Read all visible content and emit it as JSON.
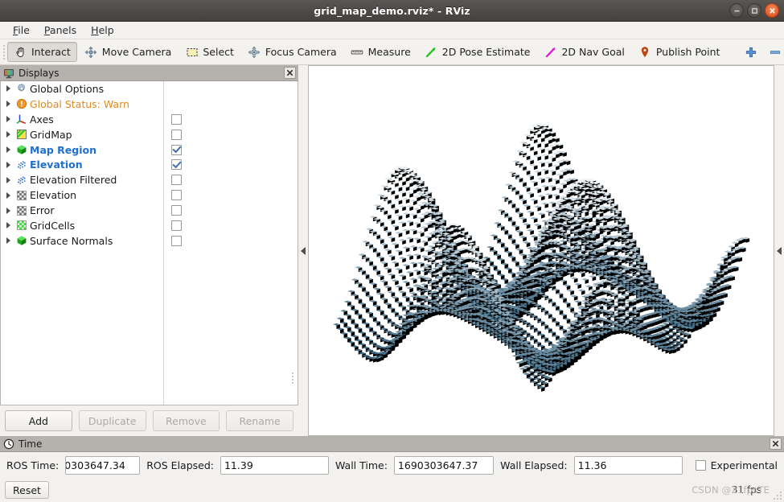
{
  "window": {
    "title": "grid_map_demo.rviz* - RViz",
    "buttons": {
      "minimize": "minimize",
      "maximize": "maximize",
      "close": "close"
    }
  },
  "menubar": {
    "items": [
      {
        "label": "File",
        "mnemonic": "F"
      },
      {
        "label": "Panels",
        "mnemonic": "P"
      },
      {
        "label": "Help",
        "mnemonic": "H"
      }
    ]
  },
  "toolbar": {
    "tools": [
      {
        "label": "Interact",
        "icon": "hand-cursor-icon",
        "active": true
      },
      {
        "label": "Move Camera",
        "icon": "move-camera-icon",
        "active": false
      },
      {
        "label": "Select",
        "icon": "select-rect-icon",
        "active": false
      },
      {
        "label": "Focus Camera",
        "icon": "focus-camera-icon",
        "active": false
      },
      {
        "label": "Measure",
        "icon": "ruler-icon",
        "active": false
      },
      {
        "label": "2D Pose Estimate",
        "icon": "green-arrow-icon",
        "active": false
      },
      {
        "label": "2D Nav Goal",
        "icon": "magenta-arrow-icon",
        "active": false
      },
      {
        "label": "Publish Point",
        "icon": "map-pin-icon",
        "active": false
      }
    ],
    "extras": [
      {
        "icon": "plus-icon",
        "label": "",
        "has_caret": false
      },
      {
        "icon": "minus-icon",
        "label": "",
        "has_caret": true
      },
      {
        "icon": "eye-icon",
        "label": "",
        "has_caret": true
      }
    ]
  },
  "displays": {
    "panel_title": "Displays",
    "panel_icon": "monitor-icon",
    "close_icon": "close-icon",
    "tree": [
      {
        "label": "Global Options",
        "icon": "gear-icon",
        "style": "normal",
        "has_checkbox": false,
        "checked": false
      },
      {
        "label": "Global Status: Warn",
        "icon": "warning-icon",
        "style": "warn",
        "has_checkbox": false,
        "checked": false
      },
      {
        "label": "Axes",
        "icon": "axes-icon",
        "style": "normal",
        "has_checkbox": true,
        "checked": false
      },
      {
        "label": "GridMap",
        "icon": "gridmap-icon",
        "style": "normal",
        "has_checkbox": true,
        "checked": false
      },
      {
        "label": "Map Region",
        "icon": "green-cube-icon",
        "style": "selected",
        "has_checkbox": true,
        "checked": true
      },
      {
        "label": "Elevation",
        "icon": "pointcloud-icon",
        "style": "selected",
        "has_checkbox": true,
        "checked": true
      },
      {
        "label": "Elevation Filtered",
        "icon": "pointcloud-icon",
        "style": "normal",
        "has_checkbox": true,
        "checked": false
      },
      {
        "label": "Elevation",
        "icon": "occupancy-grid-icon",
        "style": "normal",
        "has_checkbox": true,
        "checked": false
      },
      {
        "label": "Error",
        "icon": "occupancy-grid-icon",
        "style": "normal",
        "has_checkbox": true,
        "checked": false
      },
      {
        "label": "GridCells",
        "icon": "gridcells-icon",
        "style": "normal",
        "has_checkbox": true,
        "checked": false
      },
      {
        "label": "Surface Normals",
        "icon": "green-cube-icon",
        "style": "normal",
        "has_checkbox": true,
        "checked": false
      }
    ],
    "buttons": [
      {
        "label": "Add",
        "enabled": true
      },
      {
        "label": "Duplicate",
        "enabled": false
      },
      {
        "label": "Remove",
        "enabled": false
      },
      {
        "label": "Rename",
        "enabled": false
      }
    ]
  },
  "viewport": {
    "collapse_left_icon": "collapse-left-arrow-icon",
    "collapse_right_icon": "collapse-right-arrow-icon",
    "background": "#ffffff",
    "surface_colors": {
      "low": "#1b4f6e",
      "mid": "#6f9cb5",
      "high": "#eef3f6",
      "edge": "#2c3a42"
    }
  },
  "time": {
    "panel_title": "Time",
    "panel_icon": "clock-icon",
    "close_icon": "close-icon",
    "fields": [
      {
        "label": "ROS Time:",
        "value": "0303647.34",
        "clipped": true
      },
      {
        "label": "ROS Elapsed:",
        "value": "11.39",
        "clipped": false
      },
      {
        "label": "Wall Time:",
        "value": "1690303647.37",
        "clipped": false
      },
      {
        "label": "Wall Elapsed:",
        "value": "11.36",
        "clipped": false
      }
    ],
    "experimental": {
      "label": "Experimental",
      "checked": false
    }
  },
  "statusbar": {
    "reset_label": "Reset",
    "fps": "31 fps",
    "watermark": "CSDN @21fpsTE"
  }
}
